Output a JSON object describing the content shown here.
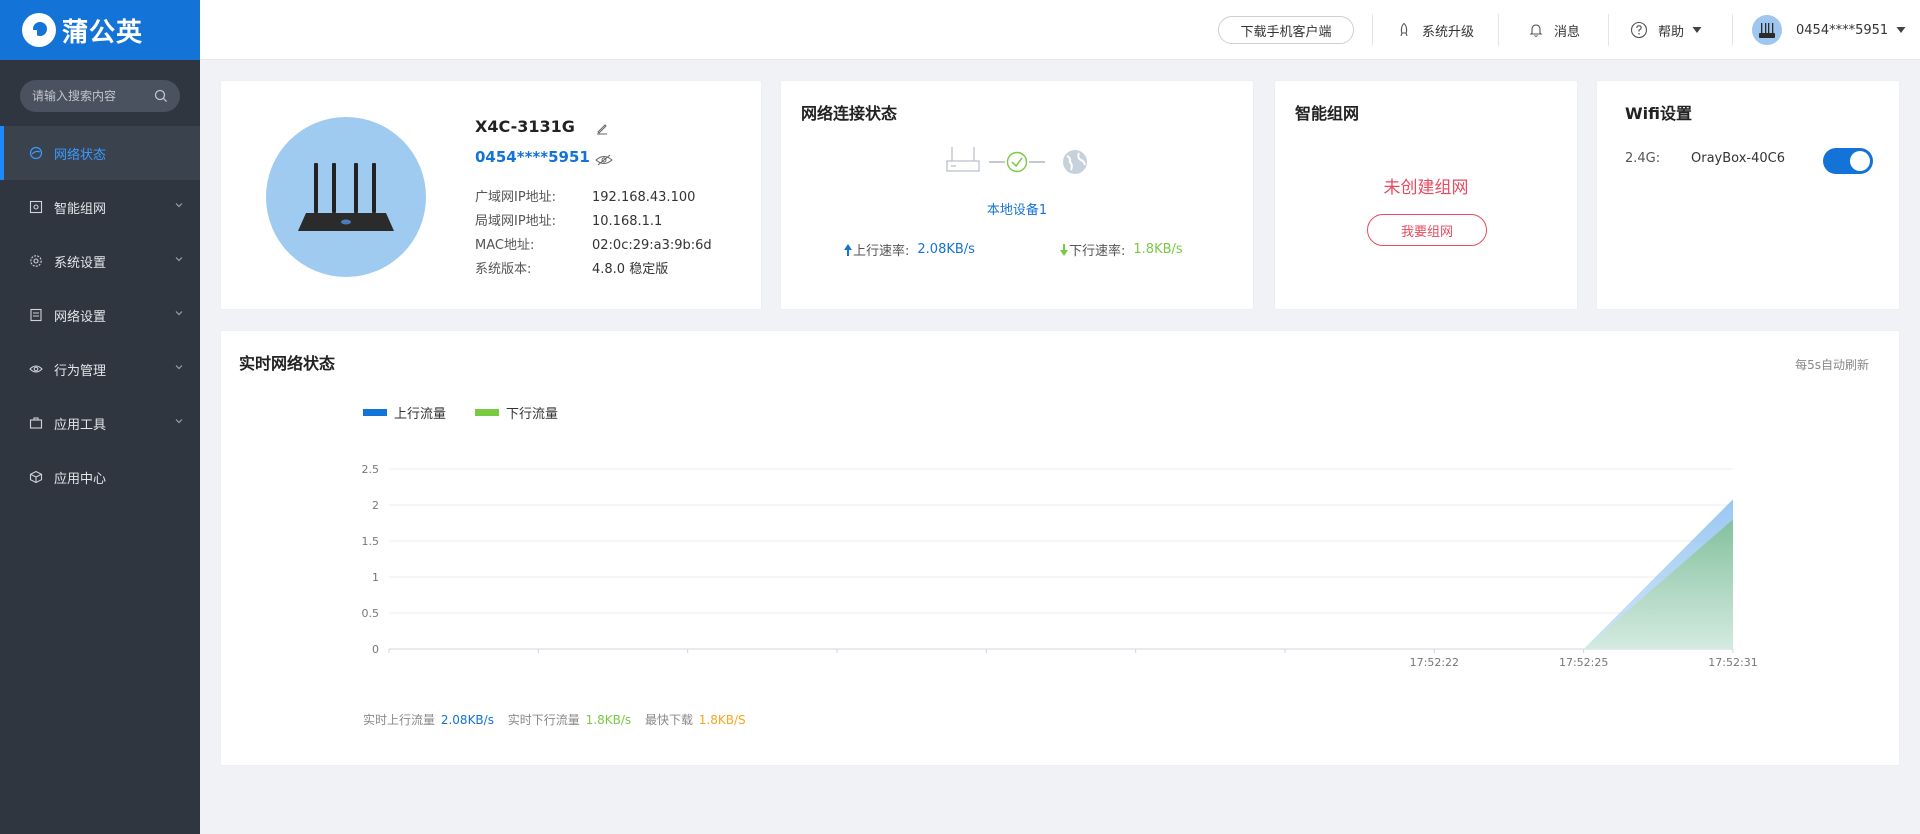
{
  "brand": {
    "name": "蒲公英",
    "color": "#1473d6"
  },
  "sidebar": {
    "search_placeholder": "请输入搜索内容",
    "items": [
      {
        "label": "网络状态",
        "active": true
      },
      {
        "label": "智能组网"
      },
      {
        "label": "系统设置"
      },
      {
        "label": "网络设置"
      },
      {
        "label": "行为管理"
      },
      {
        "label": "应用工具"
      },
      {
        "label": "应用中心"
      }
    ]
  },
  "header": {
    "download_label": "下载手机客户端",
    "upgrade_label": "系统升级",
    "message_label": "消息",
    "help_label": "帮助",
    "account": "0454****5951"
  },
  "device": {
    "model": "X4C-3131G",
    "id": "0454****5951",
    "rows": [
      {
        "label": "广域网IP地址:",
        "value": "192.168.43.100"
      },
      {
        "label": "局域网IP地址:",
        "value": "10.168.1.1"
      },
      {
        "label": "MAC地址:",
        "value": "02:0c:29:a3:9b:6d"
      },
      {
        "label": "系统版本:",
        "value": "4.8.0 稳定版"
      }
    ]
  },
  "connection": {
    "title": "网络连接状态",
    "device_label": "本地设备1",
    "up_label": "上行速率:",
    "up_value": "2.08KB/s",
    "down_label": "下行速率:",
    "down_value": "1.8KB/s"
  },
  "smartnet": {
    "title": "智能组网",
    "status": "未创建组网",
    "button": "我要组网"
  },
  "wifi": {
    "title": "Wifi设置",
    "band": "2.4G:",
    "ssid": "OrayBox-40C6",
    "enabled": true
  },
  "realtime": {
    "title": "实时网络状态",
    "refresh_note": "每5s自动刷新",
    "stats": {
      "up_label": "实时上行流量",
      "up_value": "2.08KB/s",
      "down_label": "实时下行流量",
      "down_value": "1.8KB/s",
      "peak_label": "最快下载",
      "peak_value": "1.8KB/S"
    }
  },
  "chart_data": {
    "type": "area",
    "x": [
      "",
      "",
      "",
      "",
      "",
      "",
      "",
      "17:52:22",
      "17:52:25",
      "17:52:31"
    ],
    "series": [
      {
        "name": "上行流量",
        "color": "#1473d6",
        "values": [
          0,
          0,
          0,
          0,
          0,
          0,
          0,
          0,
          0,
          2.08
        ]
      },
      {
        "name": "下行流量",
        "color": "#7ac943",
        "values": [
          0,
          0,
          0,
          0,
          0,
          0,
          0,
          0,
          0,
          1.8
        ]
      }
    ],
    "yticks": [
      "0",
      "0.5",
      "1",
      "1.5",
      "2",
      "2.5"
    ],
    "ylim": [
      0,
      2.5
    ],
    "grid": true,
    "legend": "top-left"
  }
}
